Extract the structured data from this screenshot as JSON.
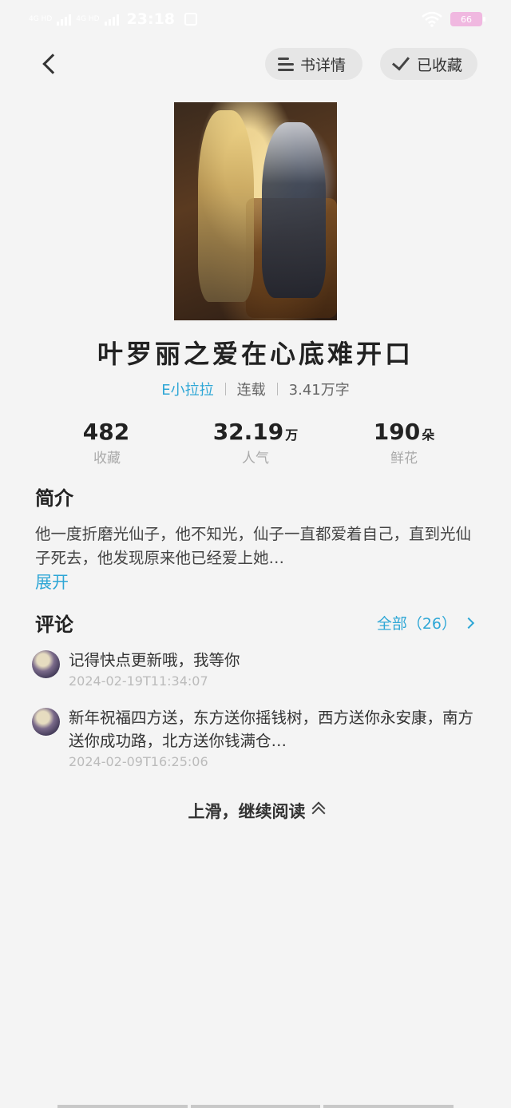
{
  "status_bar": {
    "net_top": "4G HD",
    "net_bottom": "4G HD",
    "time": "23:18",
    "battery": "66",
    "wifi_icon": "wifi-icon",
    "notification_icon": "notification-icon"
  },
  "nav": {
    "details_label": "书详情",
    "favorited_label": "已收藏"
  },
  "book": {
    "title": "叶罗丽之爱在心底难开口",
    "author": "E小拉拉",
    "status": "连载",
    "word_count": "3.41万字"
  },
  "stats": [
    {
      "value": "482",
      "unit": "",
      "label": "收藏"
    },
    {
      "value": "32.19",
      "unit": "万",
      "label": "人气"
    },
    {
      "value": "190",
      "unit": "朵",
      "label": "鲜花"
    }
  ],
  "intro": {
    "title": "简介",
    "text": "他一度折磨光仙子，他不知光，仙子一直都爱着自己，直到光仙子死去，他发现原来他已经爱上她…",
    "expand_label": "展开"
  },
  "comments": {
    "title": "评论",
    "all_label": "全部（26）",
    "items": [
      {
        "text": "记得快点更新哦，我等你",
        "time": "2024-02-19T11:34:07"
      },
      {
        "text": "新年祝福四方送，东方送你摇钱树，西方送你永安康，南方送你成功路，北方送你钱满仓…",
        "time": "2024-02-09T16:25:06"
      }
    ]
  },
  "footer": {
    "continue_label": "上滑，继续阅读"
  }
}
